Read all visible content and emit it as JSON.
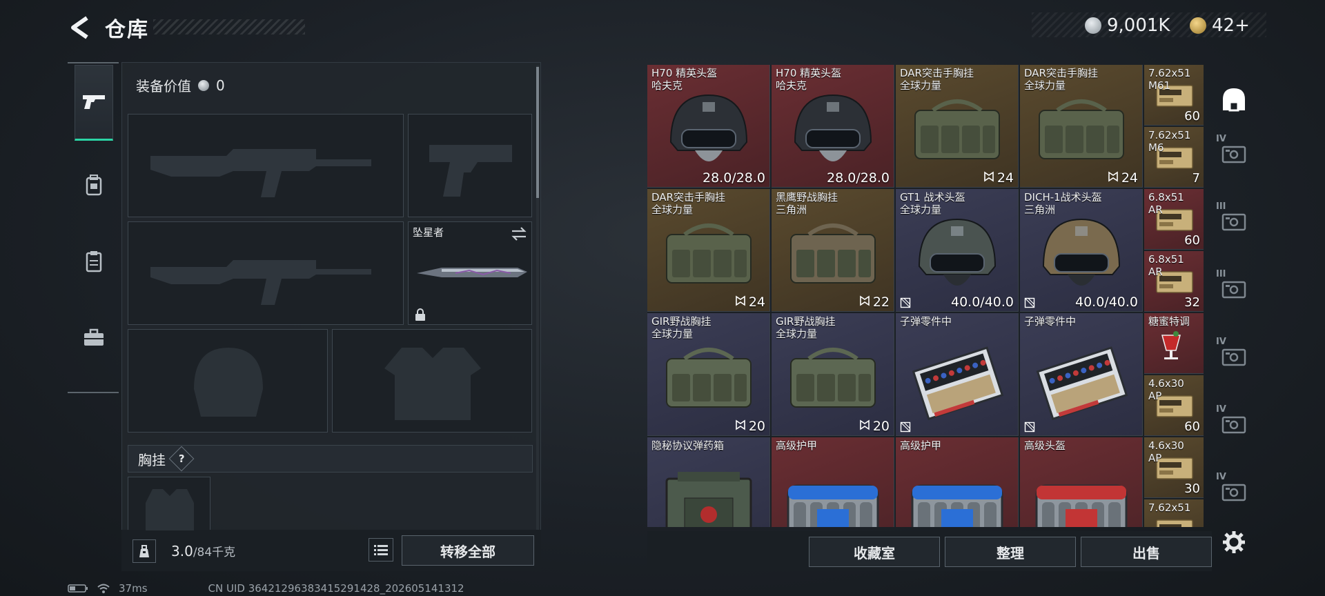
{
  "header": {
    "title": "仓库",
    "coins": "9,001K",
    "tickets": "42+"
  },
  "loadout": {
    "value_label": "装备价值",
    "value": "0",
    "melee_name": "坠星者",
    "chest_section": "胸挂",
    "help_mark": "?",
    "weight": "3.0",
    "weight_max": "/84千克",
    "transfer_all": "转移全部"
  },
  "grid": {
    "items": [
      {
        "name": "H70 精英头盔",
        "sub": "哈夫克",
        "value": "28.0/28.0",
        "color": "red",
        "art": "helmet-black"
      },
      {
        "name": "H70 精英头盔",
        "sub": "哈夫克",
        "value": "28.0/28.0",
        "color": "red",
        "art": "helmet-black"
      },
      {
        "name": "DAR突击手胸挂",
        "sub": "全球力量",
        "value": "24",
        "color": "gold",
        "art": "rig-green"
      },
      {
        "name": "DAR突击手胸挂",
        "sub": "全球力量",
        "value": "24",
        "color": "gold",
        "art": "rig-green"
      },
      {
        "name": "DAR突击手胸挂",
        "sub": "全球力量",
        "value": "24",
        "color": "gold",
        "art": "rig-green"
      },
      {
        "name": "黑鹰野战胸挂",
        "sub": "三角洲",
        "value": "22",
        "color": "gold",
        "art": "rig-tan"
      },
      {
        "name": "GT1 战术头盔",
        "sub": "全球力量",
        "value": "40.0/40.0",
        "color": "purple",
        "art": "helmet-gray"
      },
      {
        "name": "DICH-1战术头盔",
        "sub": "三角洲",
        "value": "40.0/40.0",
        "color": "purple",
        "art": "helmet-tan"
      },
      {
        "name": "GIR野战胸挂",
        "sub": "全球力量",
        "value": "20",
        "color": "purple",
        "art": "bag-green"
      },
      {
        "name": "GIR野战胸挂",
        "sub": "全球力量",
        "value": "20",
        "color": "purple",
        "art": "bag-green"
      },
      {
        "name": "子弹零件中",
        "sub": "",
        "value": "",
        "color": "purple",
        "art": "ammo-case"
      },
      {
        "name": "子弹零件中",
        "sub": "",
        "value": "",
        "color": "purple",
        "art": "ammo-case"
      },
      {
        "name": "隐秘协议弹药箱",
        "sub": "",
        "value": "",
        "color": "purple",
        "art": "ammo-box"
      },
      {
        "name": "高级护甲",
        "sub": "",
        "value": "",
        "color": "red",
        "art": "case-blue"
      },
      {
        "name": "高级护甲",
        "sub": "",
        "value": "",
        "color": "red",
        "art": "case-blue"
      },
      {
        "name": "高级头盔",
        "sub": "",
        "value": "",
        "color": "red",
        "art": "case-red"
      }
    ],
    "side_items": [
      {
        "name": "7.62x51",
        "sub": "M61",
        "value": "60",
        "color": "gold"
      },
      {
        "name": "7.62x51",
        "sub": "M6",
        "value": "7",
        "color": "gold"
      },
      {
        "name": "6.8x51",
        "sub": "AR",
        "value": "60",
        "color": "red"
      },
      {
        "name": "6.8x51",
        "sub": "AR",
        "value": "32",
        "color": "red"
      },
      {
        "name": "糖蜜特调",
        "sub": "",
        "value": "",
        "color": "red"
      },
      {
        "name": "4.6x30",
        "sub": "AP",
        "value": "60",
        "color": "gold"
      },
      {
        "name": "4.6x30",
        "sub": "AP",
        "value": "30",
        "color": "gold"
      },
      {
        "name": "7.62x51",
        "sub": "",
        "value": "",
        "color": "gold"
      }
    ]
  },
  "rail": {
    "tiers": [
      "IV",
      "III",
      "III",
      "IV",
      "IV",
      "IV"
    ]
  },
  "buttons": {
    "collection": "收藏室",
    "sort": "整理",
    "sell": "出售"
  },
  "status": {
    "ping": "37ms",
    "uid": "CN UID 3642129638341529142​8_202605141312"
  },
  "colors": {
    "accent": "#2bd4a5",
    "red_rarity": "#6a2e33",
    "gold_rarity": "#5a4a2e",
    "purple_rarity": "#3b3d55"
  }
}
